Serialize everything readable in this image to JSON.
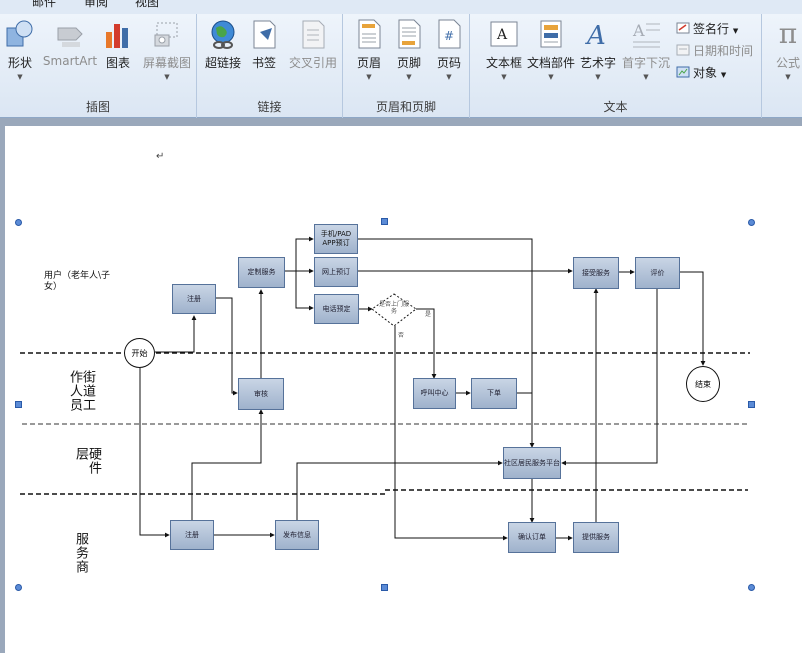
{
  "menu": {
    "items": [
      "",
      "邮件",
      "审阅",
      "视图"
    ]
  },
  "ribbon": {
    "groups": [
      {
        "label": "插图",
        "buttons": [
          {
            "label": "形状",
            "icon": "shapes-icon"
          },
          {
            "label": "SmartArt",
            "icon": "smartart-icon",
            "disabled": true
          },
          {
            "label": "图表",
            "icon": "chart-icon"
          },
          {
            "label": "屏幕截图",
            "icon": "screenshot-icon",
            "disabled": true
          }
        ]
      },
      {
        "label": "链接",
        "buttons": [
          {
            "label": "超链接",
            "icon": "hyperlink-globe-icon"
          },
          {
            "label": "书签",
            "icon": "bookmark-icon"
          },
          {
            "label": "交叉引用",
            "icon": "cross-reference-icon",
            "disabled": true
          }
        ]
      },
      {
        "label": "页眉和页脚",
        "buttons": [
          {
            "label": "页眉",
            "icon": "header-icon"
          },
          {
            "label": "页脚",
            "icon": "footer-icon"
          },
          {
            "label": "页码",
            "icon": "page-number-icon"
          }
        ]
      },
      {
        "label": "文本",
        "buttons": [
          {
            "label": "文本框",
            "icon": "textbox-icon"
          },
          {
            "label": "文档部件",
            "icon": "quick-parts-icon"
          },
          {
            "label": "艺术字",
            "icon": "wordart-icon"
          },
          {
            "label": "首字下沉",
            "icon": "dropcap-icon",
            "disabled": true
          }
        ],
        "small": [
          {
            "label": "签名行",
            "icon": "signature-line-icon"
          },
          {
            "label": "日期和时间",
            "icon": "date-time-icon",
            "disabled": true
          },
          {
            "label": "对象",
            "icon": "object-icon"
          }
        ]
      },
      {
        "label": "",
        "buttons": [
          {
            "label": "公式",
            "icon": "equation-pi-icon",
            "disabled": true
          }
        ]
      }
    ]
  },
  "document": {
    "para_mark": "↵",
    "lanes": {
      "user": "用户（老年人\\子女）",
      "street": "街道工作人员",
      "hardware": "硬件层",
      "provider": "服务商"
    },
    "nodes": {
      "start": "开始",
      "end": "结束",
      "register_user": "注册",
      "custom_service": "定制服务",
      "mobile_pad": "手机/PAD APP预订",
      "online_booking": "网上预订",
      "phone_booking": "电话预定",
      "decision": "是否上门服务",
      "review": "审核",
      "call_center": "呼叫中心",
      "place_order": "下单",
      "platform": "社区居民服务平台",
      "register_provider": "注册",
      "publish_info": "发布信息",
      "confirm_order": "确认订单",
      "provide_service": "提供服务",
      "receive_service": "接受服务",
      "evaluate": "评价",
      "yes": "是",
      "no": "否"
    }
  },
  "colors": {
    "ribbon_top": "#eef4fb",
    "ribbon_bottom": "#dbe6f3",
    "doc_background": "#9aa8bb",
    "box_fill": "#a9bbd3",
    "box_border": "#56729a",
    "handle": "#5b8bd6"
  }
}
